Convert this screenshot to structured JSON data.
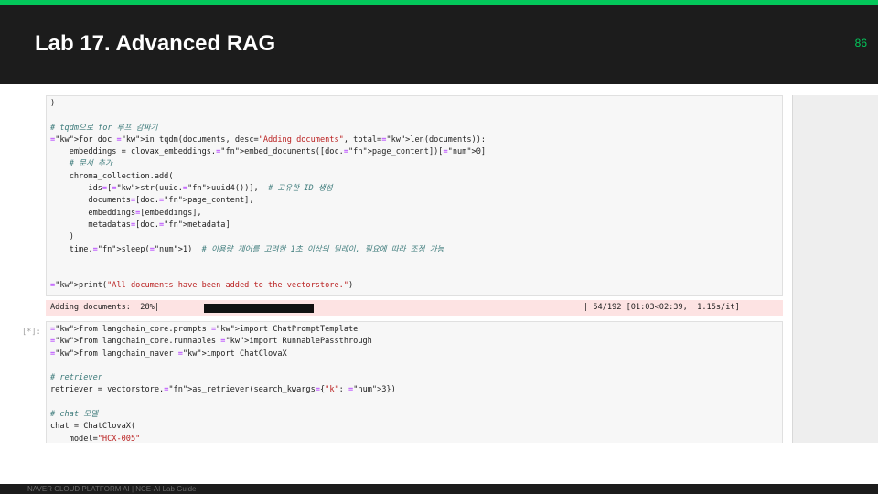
{
  "slide": {
    "title": "Lab 17. Advanced RAG",
    "page_number": "86",
    "footer": "NAVER CLOUD PLATFORM AI  |  NCE-AI Lab Guide",
    "colors": {
      "accent": "#03c75a",
      "header_bg": "#1c1c1c",
      "output_bg": "#fde3e3"
    }
  },
  "notebook": {
    "cell1_lines": [
      ")",
      "",
      "# tqdm으로 for 루프 감싸기",
      "for doc in tqdm(documents, desc=\"Adding documents\", total=len(documents)):",
      "    embeddings = clovax_embeddings.embed_documents([doc.page_content])[0]",
      "    # 문서 추가",
      "    chroma_collection.add(",
      "        ids=[str(uuid.uuid4())],  # 고유한 ID 생성",
      "        documents=[doc.page_content],",
      "        embeddings=[embeddings],",
      "        metadatas=[doc.metadata]",
      "    )",
      "    time.sleep(1)  # 이용량 제어를 고려한 1초 이상의 딜레이, 필요에 따라 조정 가능",
      "",
      "",
      "print(\"All documents have been added to the vectorstore.\")"
    ],
    "output": {
      "label": "Adding documents:  28%|",
      "stats": "| 54/192 [01:03<02:39,  1.15s/it]",
      "progress_fraction": 0.28
    },
    "cell2_prompt": "[*]:",
    "cell2_lines": [
      "from langchain_core.prompts import ChatPromptTemplate",
      "from langchain_core.runnables import RunnablePassthrough",
      "from langchain_naver import ChatClovaX",
      "",
      "# retriever",
      "retriever = vectorstore.as_retriever(search_kwargs={\"k\": 3})",
      "",
      "# chat 모델",
      "chat = ChatClovaX(",
      "    model=\"HCX-005\""
    ]
  }
}
